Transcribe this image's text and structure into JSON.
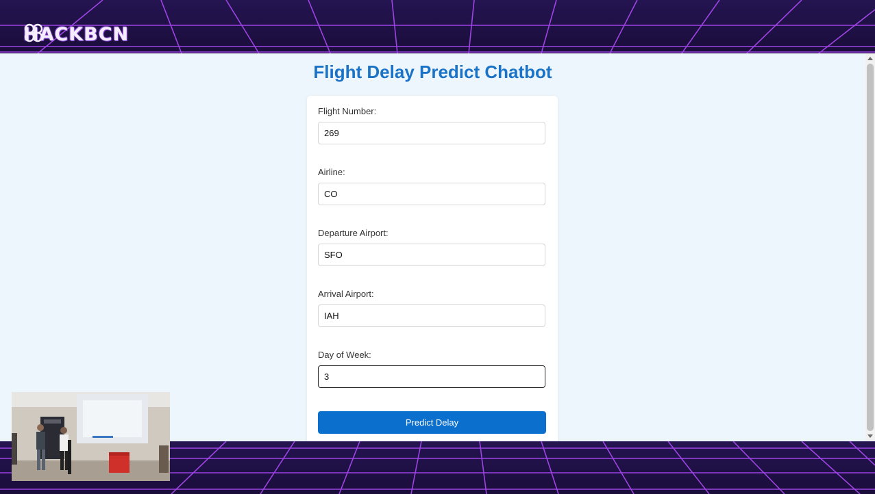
{
  "brand": {
    "logo_text": "HACKBCN"
  },
  "page": {
    "title": "Flight Delay Predict Chatbot"
  },
  "form": {
    "fields": [
      {
        "label": "Flight Number:",
        "value": "269"
      },
      {
        "label": "Airline:",
        "value": "CO"
      },
      {
        "label": "Departure Airport:",
        "value": "SFO"
      },
      {
        "label": "Arrival Airport:",
        "value": "IAH"
      },
      {
        "label": "Day of Week:",
        "value": "3"
      }
    ],
    "submit_label": "Predict Delay"
  },
  "colors": {
    "title": "#1a73c7",
    "button": "#0b6fce",
    "background": "#eef6fd",
    "frame": "#1c0f3f",
    "grid": "#b44dff"
  }
}
